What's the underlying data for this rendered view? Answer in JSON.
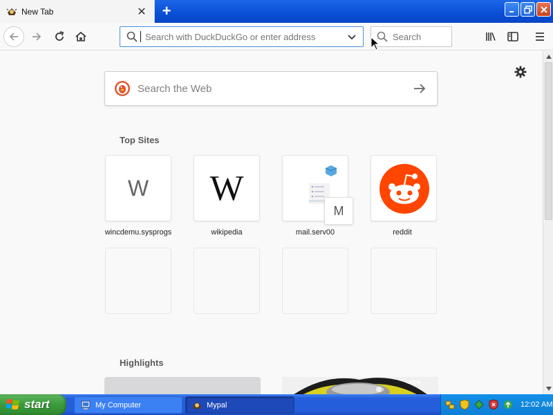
{
  "browser": {
    "tab": {
      "title": "New Tab",
      "close_glyph": "✕"
    },
    "new_tab_glyph": "+",
    "urlbar": {
      "placeholder": "Search with DuckDuckGo or enter address"
    },
    "searchbar": {
      "placeholder": "Search"
    },
    "window_controls": [
      "minimize",
      "maximize",
      "close"
    ]
  },
  "newtab": {
    "web_search_placeholder": "Search the Web",
    "top_sites_title": "Top Sites",
    "top_sites": [
      {
        "label": "wincdemu.sysprogs",
        "icon_letter": "W"
      },
      {
        "label": "wikipedia",
        "icon_letter": "W"
      },
      {
        "label": "mail.serv00",
        "icon_letter": "M"
      },
      {
        "label": "reddit",
        "icon": "reddit-icon"
      }
    ],
    "highlights_title": "Highlights"
  },
  "taskbar": {
    "start_label": "start",
    "tasks": [
      {
        "label": "My Computer",
        "icon": "computer-icon"
      },
      {
        "label": "Mypal",
        "icon": "mypal-icon"
      }
    ],
    "clock": "12:02 AM"
  },
  "colors": {
    "xp_blue": "#245edb",
    "start_green": "#3c9a3c",
    "reddit_orange": "#ff4500",
    "urlbar_focus": "#4a90d9"
  }
}
